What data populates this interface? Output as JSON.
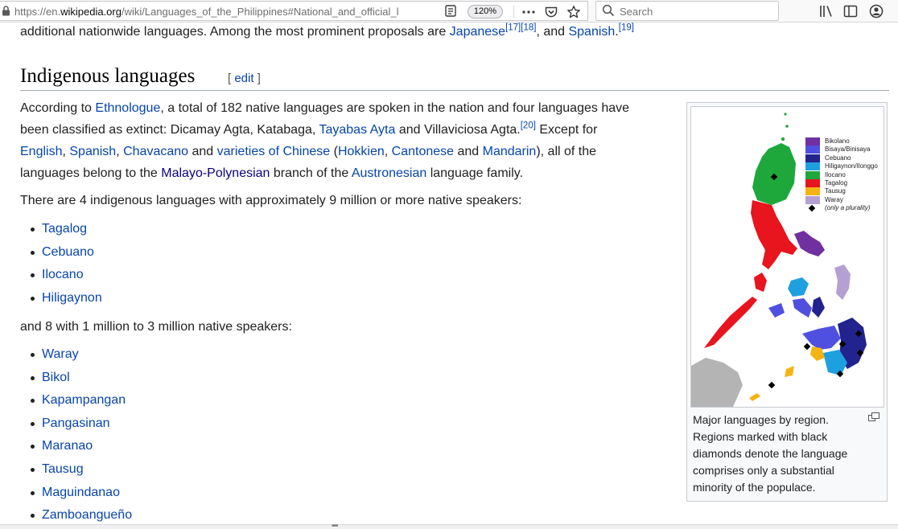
{
  "browser": {
    "url_prefix": "https://en.",
    "url_domain": "wikipedia.org",
    "url_rest": "/wiki/Languages_of_the_Philippines#National_and_official_l",
    "zoom": "120%",
    "search_placeholder": "Search"
  },
  "intro_tail": {
    "text1": "additional nationwide languages. Among the most prominent proposals are ",
    "link1": "Japanese",
    "sup1": "[17]",
    "sup2": "[18]",
    "text2": ", and ",
    "link2": "Spanish",
    "text3": ".",
    "sup3": "[19]"
  },
  "section": {
    "title": "Indigenous languages",
    "edit_open": "[ ",
    "edit": "edit",
    "edit_close": " ]"
  },
  "para1": {
    "t1": "According to ",
    "l1": "Ethnologue",
    "t2": ", a total of 182 native languages are spoken in the nation and four languages have",
    "t3": "been classified as extinct: Dicamay Agta, Katabaga, ",
    "l2": "Tayabas Ayta",
    "t4": " and Villaviciosa Agta.",
    "sup": "[20]",
    "t5": " Except for",
    "l3": "English",
    "t6": ", ",
    "l4": "Spanish",
    "t7": ", ",
    "l5": "Chavacano",
    "t8": " and ",
    "l6": "varieties of Chinese",
    "t9": " (",
    "l7": "Hokkien",
    "t10": ", ",
    "l8": "Cantonese",
    "t11": " and ",
    "l9": "Mandarin",
    "t12": "), all of the",
    "t13": "languages belong to the ",
    "l10": "Malayo-Polynesian",
    "t14": " branch of the ",
    "l11": "Austronesian",
    "t15": " language family."
  },
  "para2": "There are 4 indigenous languages with approximately 9 million or more native speakers:",
  "list_major": [
    "Tagalog",
    "Cebuano",
    "Ilocano",
    "Hiligaynon"
  ],
  "para3": "and 8 with 1 million to 3 million native speakers:",
  "list_minor": [
    "Waray",
    "Bikol",
    "Kapampangan",
    "Pangasinan",
    "Maranao",
    "Tausug",
    "Maguindanao",
    "Zamboangueño"
  ],
  "figure": {
    "legend": [
      {
        "label": "Bikolano",
        "color": "#7030a0"
      },
      {
        "label": "Bisaya/Binisaya",
        "color": "#5050e0"
      },
      {
        "label": "Cebuano",
        "color": "#23238e"
      },
      {
        "label": "Hiligaynon/Ilonggo",
        "color": "#1ea0e0"
      },
      {
        "label": "Ilocano",
        "color": "#1ea83c"
      },
      {
        "label": "Tagalog",
        "color": "#e8141e"
      },
      {
        "label": "Tausug",
        "color": "#f5b414"
      },
      {
        "label": "Waray",
        "color": "#b4a0d2"
      }
    ],
    "legend_diamond": "(only a plurality)",
    "caption": "Major languages by region. Regions marked with black diamonds denote the language comprises only a substantial minority of the populace."
  },
  "colors": {
    "link": "#0645ad",
    "link_visited": "#0b0080",
    "text": "#202122",
    "heading_rule": "#a2a9b1"
  }
}
